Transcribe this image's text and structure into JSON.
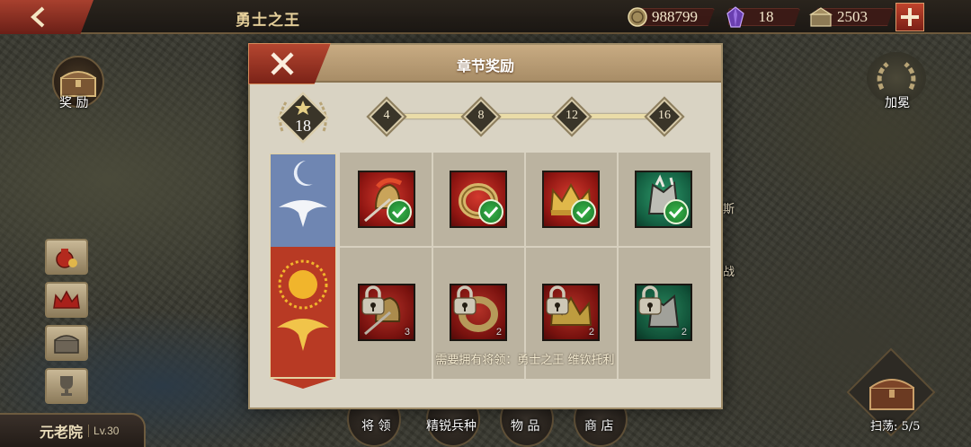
{
  "topbar": {
    "title": "勇士之王",
    "resources": [
      {
        "icon": "coin-icon",
        "value": "988799"
      },
      {
        "icon": "gem-icon",
        "value": "18"
      },
      {
        "icon": "supply-icon",
        "value": "2503"
      }
    ]
  },
  "map": {
    "reward_label": "奖 励",
    "laurel_label": "加冕",
    "fragment_1": "斯",
    "fragment_2": "战",
    "senate_name": "元老院",
    "senate_level": "Lv.30",
    "sweep_label": "扫荡: 5/5",
    "bottom_nav": [
      "将 领",
      "精锐兵种",
      "物 品",
      "商 店"
    ]
  },
  "dialog": {
    "title": "章节奖励",
    "stars": "18",
    "milestones": [
      "4",
      "8",
      "12",
      "16"
    ],
    "rewards_top": [
      {
        "icon": "helmet-icon",
        "claimed": true,
        "color": "red"
      },
      {
        "icon": "ring-icon",
        "claimed": true,
        "color": "red"
      },
      {
        "icon": "crown-icon",
        "claimed": true,
        "color": "red"
      },
      {
        "icon": "armor-icon",
        "claimed": true,
        "color": "green"
      }
    ],
    "rewards_bottom": [
      {
        "icon": "helmet-icon",
        "qty": "3",
        "locked": true,
        "color": "red"
      },
      {
        "icon": "ring-icon",
        "qty": "2",
        "locked": true,
        "color": "red"
      },
      {
        "icon": "crown-icon",
        "qty": "2",
        "locked": true,
        "color": "red"
      },
      {
        "icon": "armor-icon",
        "qty": "2",
        "locked": true,
        "color": "green"
      }
    ],
    "requirement": "需要拥有将领：勇士之王 维钦托利"
  }
}
